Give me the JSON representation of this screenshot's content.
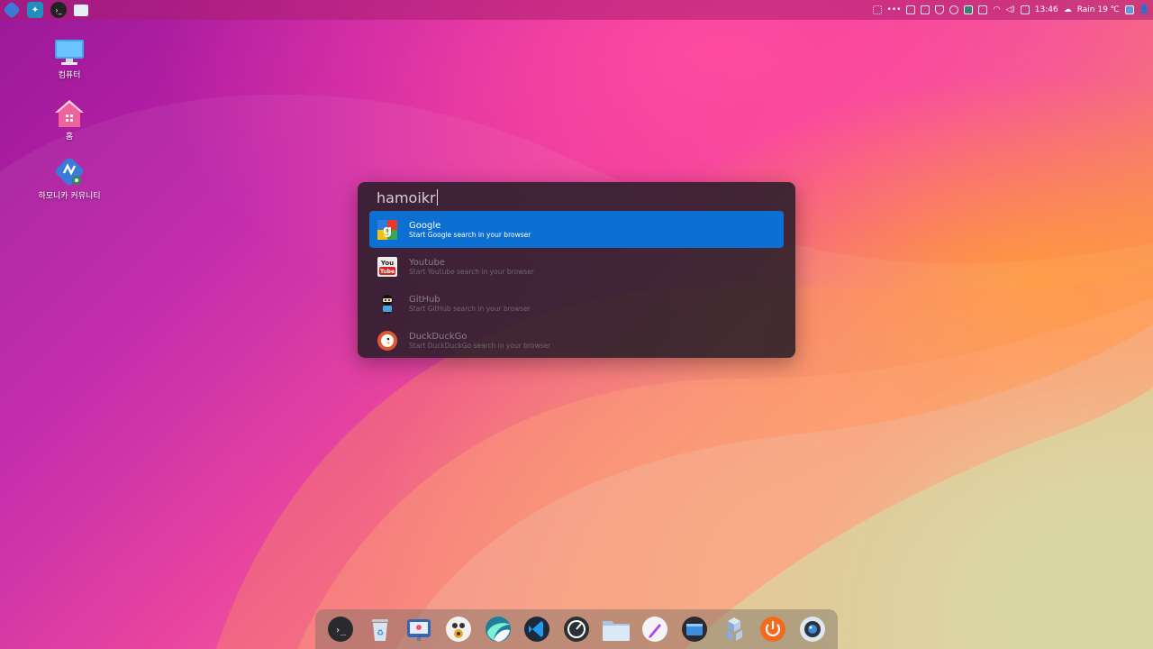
{
  "top_panel": {
    "apps": [
      {
        "icon": "harmonica-logo-icon"
      },
      {
        "icon": "bird-app-icon"
      },
      {
        "icon": "terminal-icon"
      },
      {
        "icon": "folder-icon"
      }
    ],
    "tray": {
      "clock": "13:46",
      "weather": "Rain 19 ℃"
    }
  },
  "desktop": {
    "icons": [
      {
        "label": "컴퓨터",
        "icon": "computer-icon"
      },
      {
        "label": "홈",
        "icon": "home-folder-icon"
      },
      {
        "label": "하모니카 커뮤니티",
        "icon": "harmonica-community-icon"
      }
    ]
  },
  "launcher": {
    "query": "hamoikr",
    "results": [
      {
        "name": "Google",
        "description": "Start Google search in your browser",
        "icon": "google-icon",
        "selected": true
      },
      {
        "name": "Youtube",
        "description": "Start Youtube search in your browser",
        "icon": "youtube-icon",
        "selected": false
      },
      {
        "name": "GitHub",
        "description": "Start GitHub search in your browser",
        "icon": "github-icon",
        "selected": false
      },
      {
        "name": "DuckDuckGo",
        "description": "Start DuckDuckGo search in your browser",
        "icon": "duckduckgo-icon",
        "selected": false
      }
    ]
  },
  "dock": {
    "items": [
      "terminal-icon",
      "trash-icon",
      "presentation-icon",
      "media-player-icon",
      "browser-icon",
      "vscode-icon",
      "speedometer-icon",
      "file-manager-icon",
      "text-editor-icon",
      "screenshot-icon",
      "cube-app-icon",
      "power-icon",
      "webcam-icon"
    ]
  },
  "colors": {
    "accent": "#0d6fd1"
  }
}
